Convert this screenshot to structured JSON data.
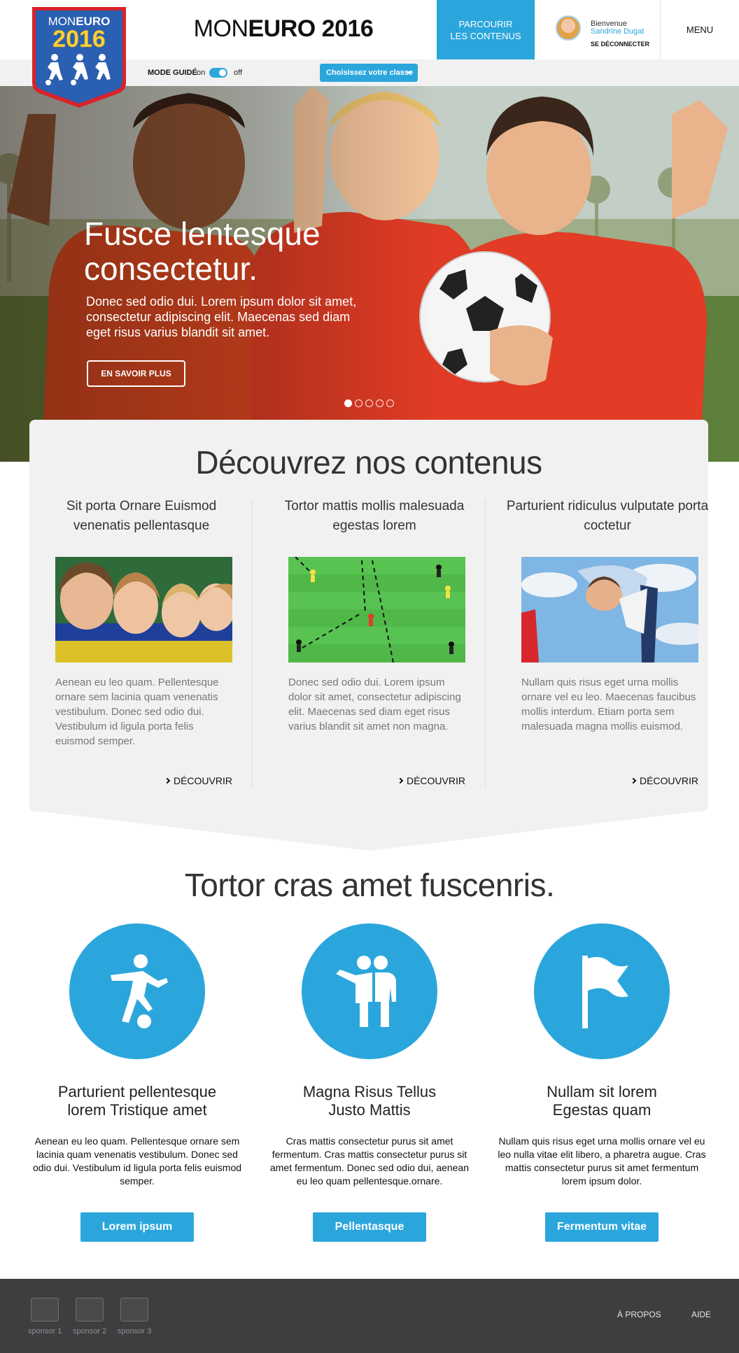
{
  "header": {
    "title_light": "MON",
    "title_bold": "EURO 2016",
    "browse_line1": "PARCOURIR",
    "browse_line2": "LES CONTENUS",
    "welcome": "Bienvenue",
    "username": "Sandrine Dugat",
    "logout": "SE DÉCONNECTER",
    "menu": "MENU"
  },
  "logo": {
    "text_mon": "MON",
    "text_euro": "EURO",
    "year": "2016"
  },
  "subbar": {
    "guided_label": "MODE GUIDÉ",
    "on_label": "on",
    "off_label": "off",
    "class_select": "Choisissez votre classe"
  },
  "hero": {
    "title": "Fusce lentesque consectetur.",
    "text": "Donec sed odio dui. Lorem ipsum dolor sit amet, consectetur adipiscing elit. Maecenas sed diam eget risus varius blandit sit amet.",
    "button": "EN SAVOIR PLUS",
    "slides": 5,
    "active_slide": 1
  },
  "discover": {
    "title": "Découvrez nos contenus",
    "columns": [
      {
        "heading": "Sit porta Ornare Euismod venenatis pellentasque",
        "text": "Aenean eu leo quam. Pellentesque ornare sem lacinia quam venenatis vestibulum. Donec sed odio dui. Vestibulum id ligula porta felis euismod semper.",
        "link": "DÉCOUVRIR"
      },
      {
        "heading": "Tortor mattis mollis malesuada egestas lorem",
        "text": "Donec sed odio dui. Lorem ipsum dolor sit amet, consectetur adipiscing elit. Maecenas sed diam eget risus varius blandit sit amet non magna.",
        "link": "DÉCOUVRIR"
      },
      {
        "heading": "Parturient ridiculus vulputate porta coctetur",
        "text": "Nullam quis risus eget urna mollis ornare vel eu leo. Maecenas faucibus mollis interdum. Etiam porta sem malesuada magna mollis euismod.",
        "link": "DÉCOUVRIR"
      }
    ]
  },
  "features": {
    "title": "Tortor cras amet fuscenris.",
    "items": [
      {
        "icon": "soccer-player-icon",
        "heading_line1": "Parturient pellentesque",
        "heading_line2": "lorem Tristique amet",
        "text": "Aenean eu leo quam. Pellentesque ornare sem lacinia quam venenatis vestibulum. Donec sed odio dui. Vestibulum id ligula porta felis euismod semper.",
        "button": "Lorem ipsum"
      },
      {
        "icon": "team-icon",
        "heading_line1": "Magna Risus Tellus",
        "heading_line2": "Justo Mattis",
        "text": "Cras mattis consectetur purus sit amet fermentum. Cras mattis consectetur purus sit amet fermentum. Donec sed odio dui, aenean eu leo quam pellentesque.ornare.",
        "button": "Pellentasque"
      },
      {
        "icon": "flag-icon",
        "heading_line1": "Nullam sit lorem",
        "heading_line2": "Egestas quam",
        "text": "Nullam quis risus eget urna mollis ornare vel eu leo nulla vitae elit libero, a pharetra augue. Cras mattis consectetur purus sit amet fermentum lorem ipsum dolor.",
        "button": "Fermentum vitae"
      }
    ]
  },
  "footer": {
    "sponsors": [
      "sponsor 1",
      "sponsor 2",
      "sponsor 3"
    ],
    "about": "À PROPOS",
    "help": "AIDE"
  },
  "colors": {
    "accent": "#2ba6dc",
    "panel": "#f1f1f1",
    "footer": "#3e3e40",
    "logo_red": "#d8232a",
    "logo_yellow": "#f7d23c"
  }
}
